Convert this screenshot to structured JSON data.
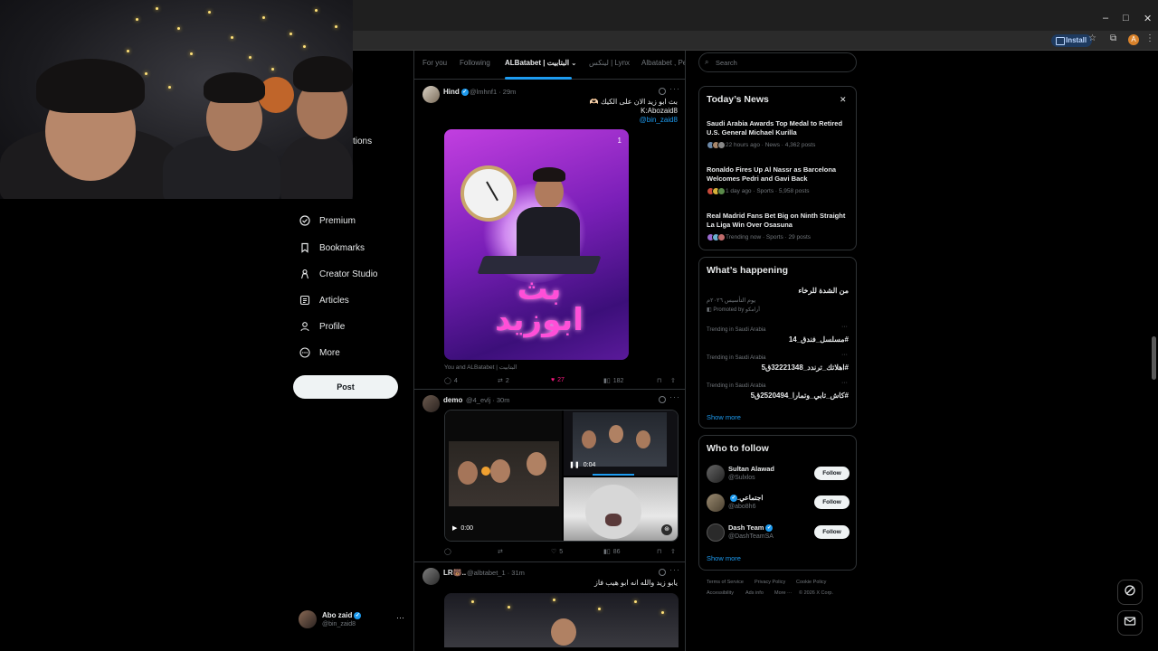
{
  "browser": {
    "install_label": "Install",
    "profile_initial": "A",
    "minimize": "–",
    "maximize": "□",
    "close": "✕"
  },
  "nav": {
    "notifications_partial": "tions",
    "items": [
      {
        "label": "Premium",
        "icon": "premium-icon"
      },
      {
        "label": "Bookmarks",
        "icon": "bookmark-icon"
      },
      {
        "label": "Creator Studio",
        "icon": "creator-studio-icon"
      },
      {
        "label": "Articles",
        "icon": "articles-icon"
      },
      {
        "label": "Profile",
        "icon": "profile-icon"
      },
      {
        "label": "More",
        "icon": "more-circle-icon"
      }
    ],
    "post_label": "Post",
    "account": {
      "name": "Abo zaid",
      "handle": "@bin_zaid8",
      "menu": "···"
    }
  },
  "tabs": [
    {
      "label": "For you"
    },
    {
      "label": "Following"
    },
    {
      "label": "ALBatabet | البتابيت",
      "active": true
    },
    {
      "label": "لينكس | Lynx"
    },
    {
      "label": "Albatabet , Pe"
    }
  ],
  "posts": [
    {
      "name": "Hind",
      "handle": "@lmhnf1 · 29m",
      "text_line1": "بث ابو زيد الان على الكيك 🫶🏻",
      "text_line2": "K:Abozaid8",
      "link": "@bin_zaid8",
      "media_badge": "1",
      "tagged": "You and ALBatabet | البتابيت",
      "replies": "4",
      "reposts": "2",
      "likes": "27",
      "views": "182"
    },
    {
      "name": "demo",
      "handle": "@4_evlj · 30m",
      "video1_time": "0:04",
      "video2_time": "0:00",
      "replies": "",
      "reposts": "",
      "likes": "5",
      "views": "86"
    },
    {
      "name": "LR🐻..",
      "handle": "@albtabet_1 · 31m",
      "text_line1": "يابو زيد والله انه ابو هيب فاز"
    }
  ],
  "search": {
    "placeholder": "Search"
  },
  "todays_news": {
    "title": "Today’s News",
    "close": "✕",
    "items": [
      {
        "title": "Saudi Arabia Awards Top Medal to Retired U.S. General Michael Kurilla",
        "meta": "22 hours ago · News · 4,362 posts"
      },
      {
        "title": "Ronaldo Fires Up Al Nassr as Barcelona Welcomes Pedri and Gavi Back",
        "meta": "1 day ago · Sports · 5,958 posts"
      },
      {
        "title": "Real Madrid Fans Bet Big on Ninth Straight La Liga Win Over Osasuna",
        "meta": "Trending now · Sports · 29 posts"
      }
    ]
  },
  "whats_happening": {
    "title": "What’s happening",
    "promo_title": "من الشدة للرخاء",
    "promo_sub": "يوم التأسيس ٢٠٢٦م",
    "promo_by": "أرامكو",
    "promo_label": "Promoted by أرامكو",
    "trends": [
      {
        "meta": "Trending in Saudi Arabia",
        "name": "#مسلسل_فندق_14"
      },
      {
        "meta": "Trending in Saudi Arabia",
        "name": "#اهلاتك_ترندد_32221348ق5"
      },
      {
        "meta": "Trending in Saudi Arabia",
        "name": "#كاش_تابي_وتمارا_2520494ق5"
      }
    ],
    "show_more": "Show more"
  },
  "who_to_follow": {
    "title": "Who to follow",
    "users": [
      {
        "name": "Sultan Alawad",
        "handle": "@Sulxlos",
        "button": "Follow"
      },
      {
        "name": "اجتماعي.",
        "handle": "@abo8h6",
        "button": "Follow"
      },
      {
        "name": "Dash Team",
        "handle": "@DashTeamSA",
        "button": "Follow"
      }
    ],
    "show_more": "Show more"
  },
  "footer": {
    "links": [
      "Terms of Service",
      "Privacy Policy",
      "Cookie Policy",
      "Accessibility",
      "Ads info",
      "More ···",
      "© 2026 X Corp."
    ]
  },
  "colors": {
    "accent": "#1d9bf0",
    "like": "#f91880",
    "bg": "#000000"
  }
}
